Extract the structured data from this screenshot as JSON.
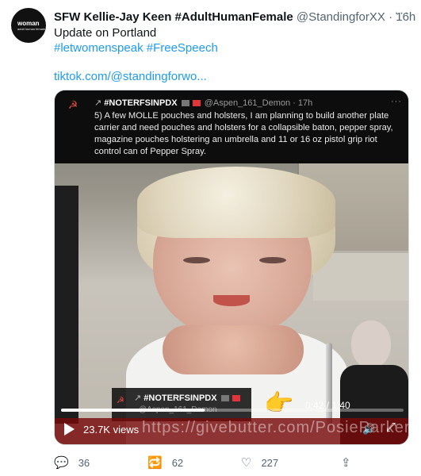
{
  "tweet": {
    "avatar_text": [
      "woman",
      "adult human female"
    ],
    "display_name": "SFW Kellie-Jay Keen #AdultHumanFemale",
    "handle": "@StandingforXX",
    "separator": "·",
    "time": "16h",
    "more_icon": "more-dots-icon",
    "text_line1": "Update on Portland",
    "hashtags": "#letwomenspeak #FreeSpeech",
    "link": "tiktok.com/@standingforwo..."
  },
  "video": {
    "overlay": {
      "title": "#NOTERFSINPDX",
      "handle": "@Aspen_161_Demon",
      "separator": "·",
      "time": "17h",
      "body": "5) A few MOLLE pouches and holsters, I am planning to build another plate carrier and need pouches and holsters for a collapsible baton, pepper spray, magazine pouches holstering an umbrella and 11 or 16 oz pistol grip riot control can of Pepper Spray."
    },
    "mid_overlay": {
      "title": "#NOTERFSINPDX",
      "handle": "@Aspen_161_Demon"
    },
    "views": "23.7K views",
    "watermark": "https://givebutter.com/PosieParkerUSAtoC",
    "time": "0:42 / 1:40",
    "progress": 0.42
  },
  "actions": {
    "reply_count": "36",
    "retweet_count": "62",
    "like_count": "227"
  },
  "colors": {
    "link": "#1d9bf0",
    "secondary_text": "#536471",
    "video_bar": "#7a0a0a"
  }
}
